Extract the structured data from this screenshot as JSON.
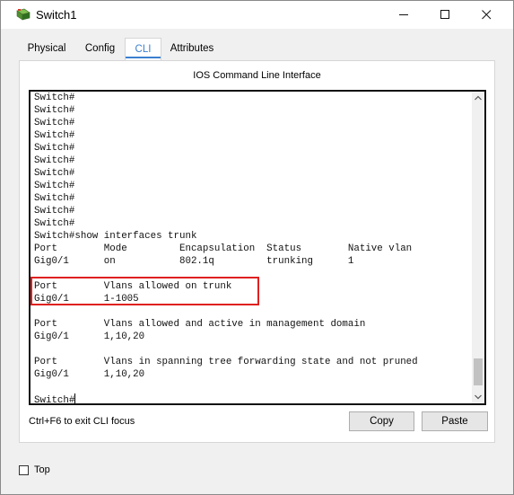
{
  "window": {
    "title": "Switch1"
  },
  "tabs": [
    {
      "label": "Physical"
    },
    {
      "label": "Config"
    },
    {
      "label": "CLI"
    },
    {
      "label": "Attributes"
    }
  ],
  "panel": {
    "header": "IOS Command Line Interface"
  },
  "terminal": {
    "lines": [
      "Switch#",
      "Switch#",
      "Switch#",
      "Switch#",
      "Switch#",
      "Switch#",
      "Switch#",
      "Switch#",
      "Switch#",
      "Switch#",
      "Switch#",
      "Switch#show interfaces trunk",
      "Port        Mode         Encapsulation  Status        Native vlan",
      "Gig0/1      on           802.1q         trunking      1",
      "",
      "Port        Vlans allowed on trunk",
      "Gig0/1      1-1005",
      "",
      "Port        Vlans allowed and active in management domain",
      "Gig0/1      1,10,20",
      "",
      "Port        Vlans in spanning tree forwarding state and not pruned",
      "Gig0/1      1,10,20",
      "",
      "Switch#"
    ],
    "highlight_color": "#e02020"
  },
  "footer": {
    "hint": "Ctrl+F6 to exit CLI focus",
    "copy_label": "Copy",
    "paste_label": "Paste"
  },
  "bottom": {
    "top_label": "Top"
  },
  "colors": {
    "accent": "#3b7fd0"
  }
}
